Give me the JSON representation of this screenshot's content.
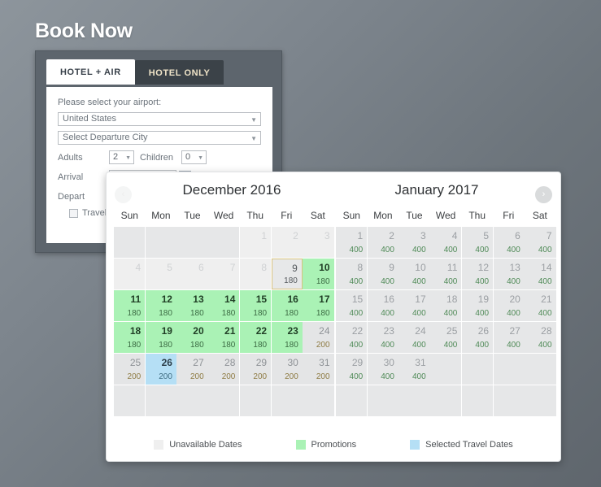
{
  "page": {
    "title": "Book Now"
  },
  "booking": {
    "tabs": [
      {
        "label": "HOTEL + AIR",
        "active": true
      },
      {
        "label": "HOTEL ONLY",
        "active": false
      }
    ],
    "airport_prompt": "Please select your airport:",
    "country_select": {
      "value": "United States",
      "caret": "▼"
    },
    "city_select": {
      "value": "Select Departure City",
      "caret": "▼"
    },
    "adults": {
      "label": "Adults",
      "value": "2",
      "caret": "▼"
    },
    "children": {
      "label": "Children",
      "value": "0",
      "caret": "▼"
    },
    "arrival": {
      "label": "Arrival",
      "value": "",
      "placeholder": ""
    },
    "depart": {
      "label": "Depart"
    },
    "travel_checkbox": {
      "label": "Travel A",
      "checked": false
    }
  },
  "calendar": {
    "prev_label": "‹",
    "next_label": "›",
    "months": [
      {
        "title": "December 2016",
        "dow": [
          "Sun",
          "Mon",
          "Tue",
          "Wed",
          "Thu",
          "Fri",
          "Sat"
        ],
        "weeks": [
          [
            {
              "day": "",
              "price": "",
              "state": "empty"
            },
            {
              "day": "",
              "price": "",
              "state": "empty"
            },
            {
              "day": "",
              "price": "",
              "state": "empty"
            },
            {
              "day": "",
              "price": "",
              "state": "empty"
            },
            {
              "day": "1",
              "price": "",
              "state": "unavail"
            },
            {
              "day": "2",
              "price": "",
              "state": "unavail"
            },
            {
              "day": "3",
              "price": "",
              "state": "unavail"
            }
          ],
          [
            {
              "day": "4",
              "price": "",
              "state": "unavail"
            },
            {
              "day": "5",
              "price": "",
              "state": "unavail"
            },
            {
              "day": "6",
              "price": "",
              "state": "unavail"
            },
            {
              "day": "7",
              "price": "",
              "state": "unavail"
            },
            {
              "day": "8",
              "price": "",
              "state": "unavail"
            },
            {
              "day": "9",
              "price": "180",
              "state": "today"
            },
            {
              "day": "10",
              "price": "180",
              "state": "promo"
            }
          ],
          [
            {
              "day": "11",
              "price": "180",
              "state": "promo"
            },
            {
              "day": "12",
              "price": "180",
              "state": "promo"
            },
            {
              "day": "13",
              "price": "180",
              "state": "promo"
            },
            {
              "day": "14",
              "price": "180",
              "state": "promo"
            },
            {
              "day": "15",
              "price": "180",
              "state": "promo"
            },
            {
              "day": "16",
              "price": "180",
              "state": "promo"
            },
            {
              "day": "17",
              "price": "180",
              "state": "promo"
            }
          ],
          [
            {
              "day": "18",
              "price": "180",
              "state": "promo"
            },
            {
              "day": "19",
              "price": "180",
              "state": "promo"
            },
            {
              "day": "20",
              "price": "180",
              "state": "promo"
            },
            {
              "day": "21",
              "price": "180",
              "state": "promo"
            },
            {
              "day": "22",
              "price": "180",
              "state": "promo"
            },
            {
              "day": "23",
              "price": "180",
              "state": "promo"
            },
            {
              "day": "24",
              "price": "200",
              "state": "normal"
            }
          ],
          [
            {
              "day": "25",
              "price": "200",
              "state": "normal"
            },
            {
              "day": "26",
              "price": "200",
              "state": "selected"
            },
            {
              "day": "27",
              "price": "200",
              "state": "normal"
            },
            {
              "day": "28",
              "price": "200",
              "state": "normal"
            },
            {
              "day": "29",
              "price": "200",
              "state": "normal"
            },
            {
              "day": "30",
              "price": "200",
              "state": "normal"
            },
            {
              "day": "31",
              "price": "200",
              "state": "normal"
            }
          ],
          [
            {
              "day": "",
              "price": "",
              "state": "empty"
            },
            {
              "day": "",
              "price": "",
              "state": "empty"
            },
            {
              "day": "",
              "price": "",
              "state": "empty"
            },
            {
              "day": "",
              "price": "",
              "state": "empty"
            },
            {
              "day": "",
              "price": "",
              "state": "empty"
            },
            {
              "day": "",
              "price": "",
              "state": "empty"
            },
            {
              "day": "",
              "price": "",
              "state": "empty"
            }
          ]
        ]
      },
      {
        "title": "January 2017",
        "dow": [
          "Sun",
          "Mon",
          "Tue",
          "Wed",
          "Thu",
          "Fri",
          "Sat"
        ],
        "weeks": [
          [
            {
              "day": "1",
              "price": "400",
              "state": "avail"
            },
            {
              "day": "2",
              "price": "400",
              "state": "avail"
            },
            {
              "day": "3",
              "price": "400",
              "state": "avail"
            },
            {
              "day": "4",
              "price": "400",
              "state": "avail"
            },
            {
              "day": "5",
              "price": "400",
              "state": "avail"
            },
            {
              "day": "6",
              "price": "400",
              "state": "avail"
            },
            {
              "day": "7",
              "price": "400",
              "state": "avail"
            }
          ],
          [
            {
              "day": "8",
              "price": "400",
              "state": "avail"
            },
            {
              "day": "9",
              "price": "400",
              "state": "avail"
            },
            {
              "day": "10",
              "price": "400",
              "state": "avail"
            },
            {
              "day": "11",
              "price": "400",
              "state": "avail"
            },
            {
              "day": "12",
              "price": "400",
              "state": "avail"
            },
            {
              "day": "13",
              "price": "400",
              "state": "avail"
            },
            {
              "day": "14",
              "price": "400",
              "state": "avail"
            }
          ],
          [
            {
              "day": "15",
              "price": "400",
              "state": "avail"
            },
            {
              "day": "16",
              "price": "400",
              "state": "avail"
            },
            {
              "day": "17",
              "price": "400",
              "state": "avail"
            },
            {
              "day": "18",
              "price": "400",
              "state": "avail"
            },
            {
              "day": "19",
              "price": "400",
              "state": "avail"
            },
            {
              "day": "20",
              "price": "400",
              "state": "avail"
            },
            {
              "day": "21",
              "price": "400",
              "state": "avail"
            }
          ],
          [
            {
              "day": "22",
              "price": "400",
              "state": "avail"
            },
            {
              "day": "23",
              "price": "400",
              "state": "avail"
            },
            {
              "day": "24",
              "price": "400",
              "state": "avail"
            },
            {
              "day": "25",
              "price": "400",
              "state": "avail"
            },
            {
              "day": "26",
              "price": "400",
              "state": "avail"
            },
            {
              "day": "27",
              "price": "400",
              "state": "avail"
            },
            {
              "day": "28",
              "price": "400",
              "state": "avail"
            }
          ],
          [
            {
              "day": "29",
              "price": "400",
              "state": "avail"
            },
            {
              "day": "30",
              "price": "400",
              "state": "avail"
            },
            {
              "day": "31",
              "price": "400",
              "state": "avail"
            },
            {
              "day": "",
              "price": "",
              "state": "empty"
            },
            {
              "day": "",
              "price": "",
              "state": "empty"
            },
            {
              "day": "",
              "price": "",
              "state": "empty"
            },
            {
              "day": "",
              "price": "",
              "state": "empty"
            }
          ],
          [
            {
              "day": "",
              "price": "",
              "state": "empty"
            },
            {
              "day": "",
              "price": "",
              "state": "empty"
            },
            {
              "day": "",
              "price": "",
              "state": "empty"
            },
            {
              "day": "",
              "price": "",
              "state": "empty"
            },
            {
              "day": "",
              "price": "",
              "state": "empty"
            },
            {
              "day": "",
              "price": "",
              "state": "empty"
            },
            {
              "day": "",
              "price": "",
              "state": "empty"
            }
          ]
        ]
      }
    ],
    "legend": [
      {
        "label": "Unavailable Dates",
        "color": "#efefef"
      },
      {
        "label": "Promotions",
        "color": "#aaf2b5"
      },
      {
        "label": "Selected Travel Dates",
        "color": "#b5dff5"
      }
    ]
  }
}
